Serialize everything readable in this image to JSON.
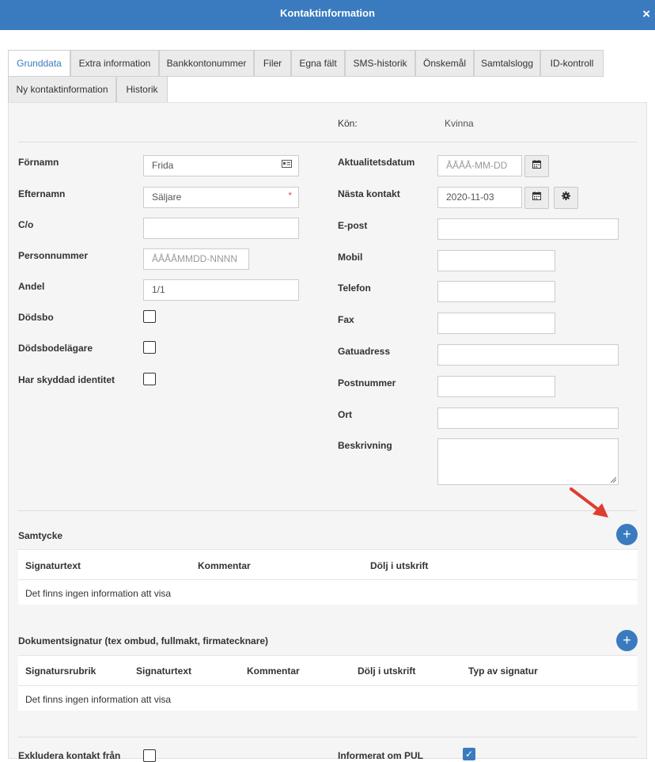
{
  "window": {
    "title": "Kontaktinformation",
    "close": "×"
  },
  "tabs": [
    "Grunddata",
    "Extra information",
    "Bankkontonummer",
    "Filer",
    "Egna fält",
    "SMS-historik",
    "Önskemål",
    "Samtalslogg",
    "ID-kontroll",
    "Ny kontaktinformation",
    "Historik"
  ],
  "gender": {
    "label": "Kön:",
    "value": "Kvinna"
  },
  "left_fields": {
    "firstname": {
      "label": "Förnamn",
      "value": "Frida"
    },
    "lastname": {
      "label": "Efternamn",
      "value": "Säljare",
      "required": "*"
    },
    "co": {
      "label": "C/o",
      "value": ""
    },
    "personnummer": {
      "label": "Personnummer",
      "placeholder": "ÅÅÅÅMMDD-NNNN"
    },
    "andel": {
      "label": "Andel",
      "value": "1/1"
    },
    "dodsbo": {
      "label": "Dödsbo"
    },
    "dodsbodelagare": {
      "label": "Dödsbodelägare"
    },
    "skyddad": {
      "label": "Har skyddad identitet"
    }
  },
  "right_fields": {
    "aktualitetsdatum": {
      "label": "Aktualitetsdatum",
      "placeholder": "ÅÅÅÅ-MM-DD"
    },
    "nasta_kontakt": {
      "label": "Nästa kontakt",
      "value": "2020-11-03"
    },
    "epost": {
      "label": "E-post"
    },
    "mobil": {
      "label": "Mobil"
    },
    "telefon": {
      "label": "Telefon"
    },
    "fax": {
      "label": "Fax"
    },
    "gatuadress": {
      "label": "Gatuadress"
    },
    "postnummer": {
      "label": "Postnummer"
    },
    "ort": {
      "label": "Ort"
    },
    "beskrivning": {
      "label": "Beskrivning"
    }
  },
  "samtycke": {
    "title": "Samtycke",
    "columns": [
      "Signaturtext",
      "Kommentar",
      "Dölj i utskrift"
    ],
    "empty": "Det finns ingen information att visa"
  },
  "dokumentsignatur": {
    "title": "Dokumentsignatur (tex ombud, fullmakt, firmatecknare)",
    "columns": [
      "Signatursrubrik",
      "Signaturtext",
      "Kommentar",
      "Dölj i utskrift",
      "Typ av signatur"
    ],
    "empty": "Det finns ingen information att visa"
  },
  "bottom": {
    "exkludera": {
      "label": "Exkludera kontakt från"
    },
    "informerat": {
      "label": "Informerat om PUL"
    }
  },
  "icons": {
    "calendar": "calendar-icon",
    "gear": "gear-icon",
    "id_card": "id-card-icon",
    "plus": "plus-icon"
  },
  "colors": {
    "accent": "#3a7bbf",
    "required": "#d9534f",
    "arrow": "#e03c31"
  }
}
